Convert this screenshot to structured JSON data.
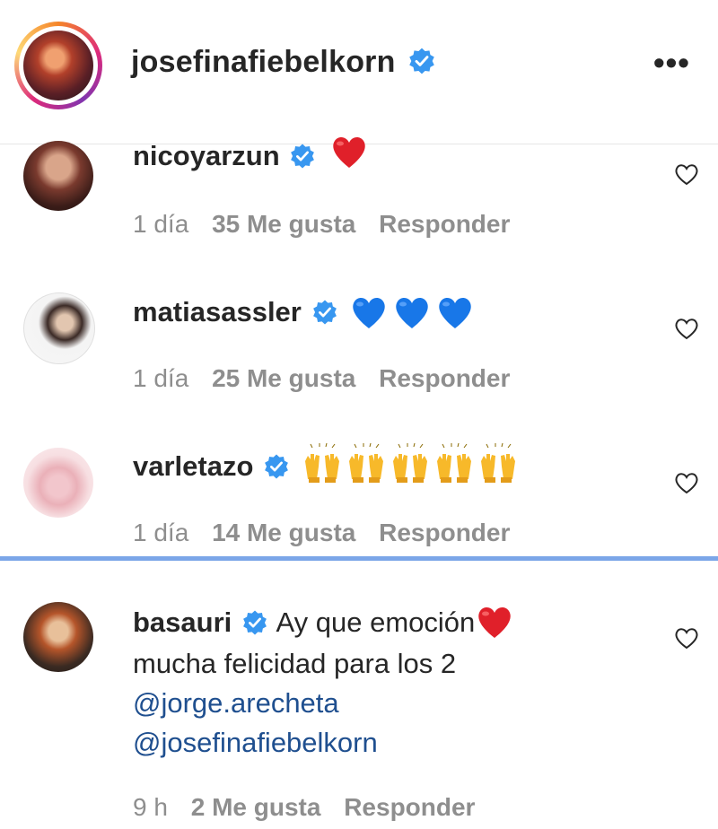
{
  "header": {
    "username": "josefinafiebelkorn",
    "more_label": "•••"
  },
  "comments": [
    {
      "username": "nicoyarzun",
      "text": "",
      "emoji": "red-heart",
      "time": "1 día",
      "likes": "35 Me gusta",
      "reply": "Responder"
    },
    {
      "username": "matiasassler",
      "text": "",
      "emoji": "blue-heart x3",
      "time": "1 día",
      "likes": "25 Me gusta",
      "reply": "Responder"
    },
    {
      "username": "varletazo",
      "text": "",
      "emoji": "raising-hands x5",
      "time": "1 día",
      "likes": "14 Me gusta",
      "reply": "Responder"
    },
    {
      "username": "basauri",
      "text_line1": "Ay que emoción",
      "text_line2": "mucha felicidad para los 2",
      "mention1": "@jorge.arecheta",
      "mention2": "@josefinafiebelkorn",
      "emoji": "red-heart",
      "time": "9 h",
      "likes": "2 Me gusta",
      "reply": "Responder"
    }
  ],
  "colors": {
    "verified": "#3897f0",
    "divider": "#7ba6e8",
    "mention": "#1f4f8f",
    "meta": "#8e8e8e"
  }
}
